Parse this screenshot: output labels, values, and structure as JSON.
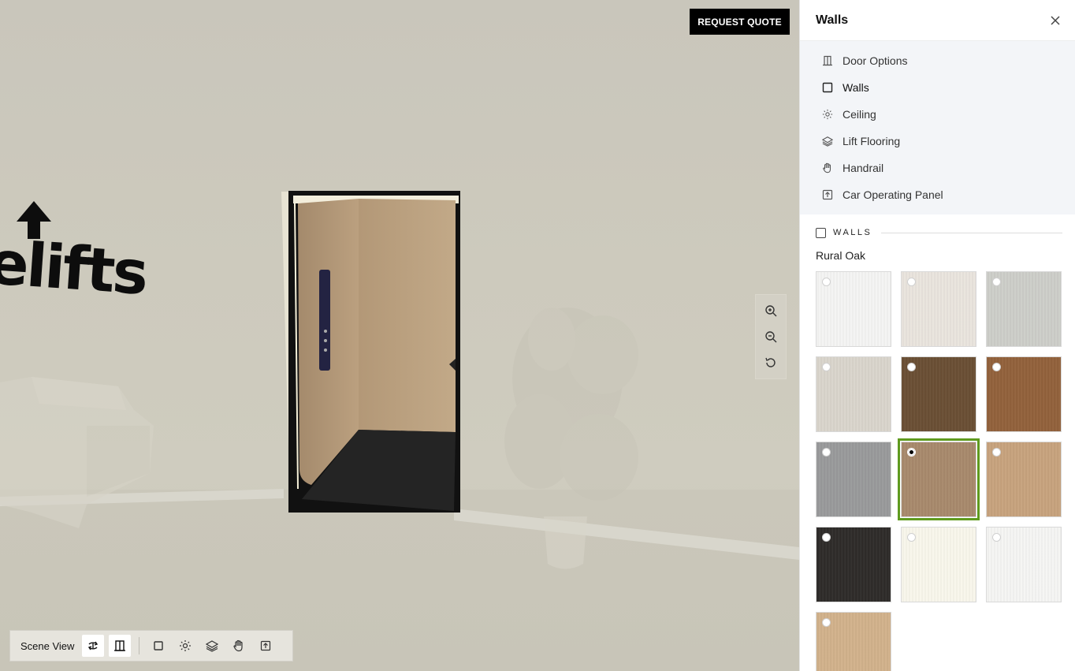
{
  "scene": {
    "logo_text": "elifts",
    "request_quote_label": "REQUEST QUOTE",
    "zoom_controls": [
      {
        "name": "zoom-in-icon"
      },
      {
        "name": "zoom-out-icon"
      },
      {
        "name": "reset-view-icon"
      }
    ],
    "toolbar": {
      "label": "Scene View",
      "buttons": [
        {
          "name": "rotate-view-icon",
          "active": true
        },
        {
          "name": "door-view-icon",
          "active": true
        },
        {
          "name": "walls-icon",
          "active": false
        },
        {
          "name": "ceiling-light-icon",
          "active": false
        },
        {
          "name": "layers-icon",
          "active": false
        },
        {
          "name": "hand-icon",
          "active": false
        },
        {
          "name": "panel-up-icon",
          "active": false
        }
      ]
    }
  },
  "panel": {
    "title": "Walls",
    "nav": [
      {
        "label": "Door Options",
        "icon": "door-icon"
      },
      {
        "label": "Walls",
        "icon": "square-icon"
      },
      {
        "label": "Ceiling",
        "icon": "sun-icon"
      },
      {
        "label": "Lift Flooring",
        "icon": "layers-icon"
      },
      {
        "label": "Handrail",
        "icon": "hand-icon"
      },
      {
        "label": "Car Operating Panel",
        "icon": "upload-box-icon"
      }
    ],
    "section_label": "WALLS",
    "selected_name": "Rural Oak",
    "swatches": [
      {
        "color": "#f7f7f6",
        "selected": false
      },
      {
        "color": "#ece7e0",
        "selected": false
      },
      {
        "color": "#cfd0cb",
        "selected": false
      },
      {
        "color": "#dcd7ce",
        "selected": false
      },
      {
        "color": "#6a4e33",
        "selected": false
      },
      {
        "color": "#93613a",
        "selected": false
      },
      {
        "color": "#9a9b9c",
        "selected": false
      },
      {
        "color": "#a98a6c",
        "selected": true
      },
      {
        "color": "#c9a47e",
        "selected": false
      },
      {
        "color": "#2d2a28",
        "selected": false
      },
      {
        "color": "#fbf9ee",
        "selected": false
      },
      {
        "color": "#f8f8f6",
        "selected": false
      },
      {
        "color": "#d4b38c",
        "selected": false
      }
    ]
  }
}
